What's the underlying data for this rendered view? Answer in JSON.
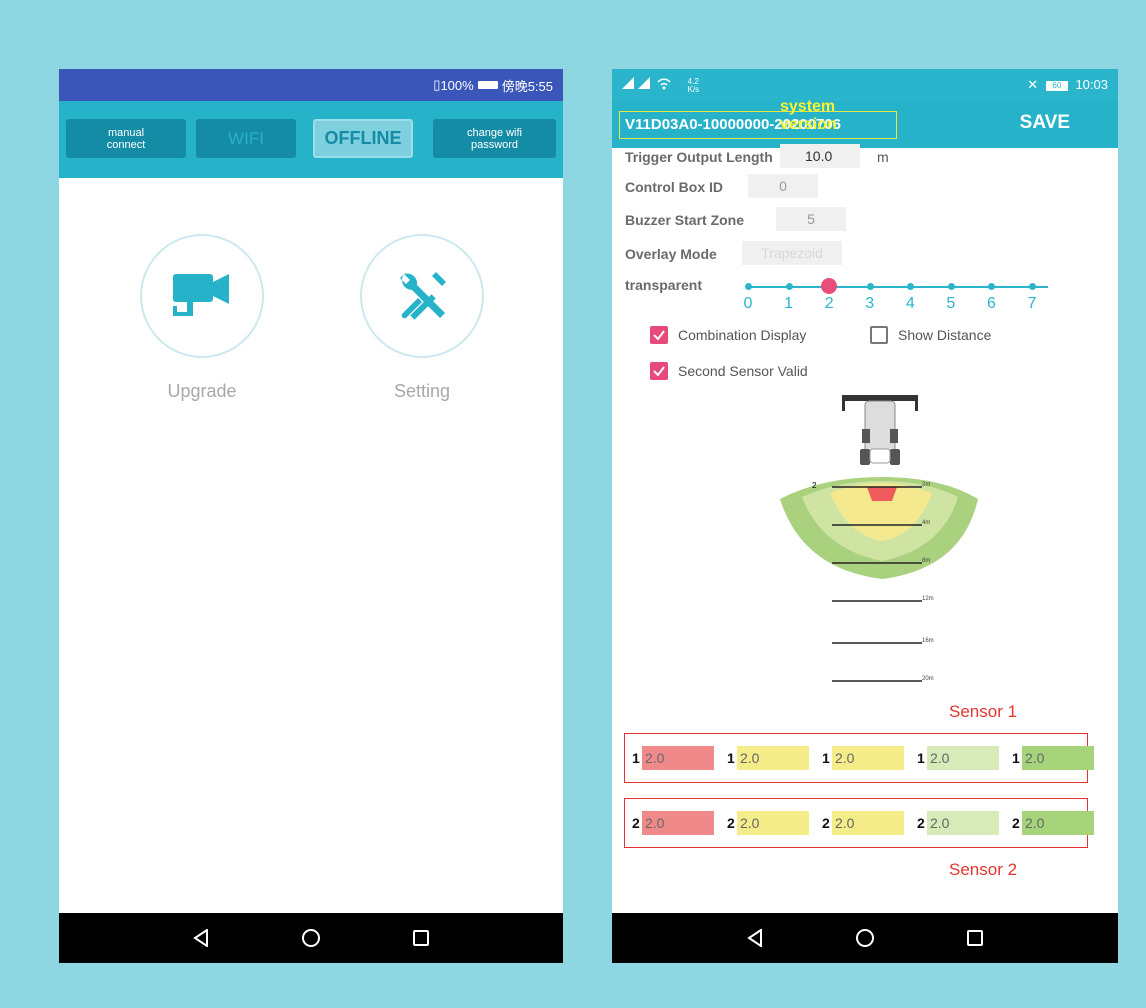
{
  "left_phone": {
    "status": {
      "sim_icon": "sim-icon",
      "battery_percent": "100%",
      "time": "傍晚5:55"
    },
    "toolbar": {
      "manual_connect": [
        "manual",
        "connect"
      ],
      "wifi": "WIFI",
      "offline": "OFFLINE",
      "change_wifi_password": [
        "change wifi",
        "password"
      ]
    },
    "menu": [
      {
        "label": "Upgrade",
        "icon": "camera-icon"
      },
      {
        "label": "Setting",
        "icon": "tools-icon"
      }
    ],
    "nav": [
      "back-icon",
      "home-icon",
      "recents-icon"
    ]
  },
  "right_phone": {
    "status": {
      "network_speed": "4.2",
      "network_speed_unit": "K/s",
      "battery_level": "60",
      "time": "10:03"
    },
    "version_note": "system  version",
    "version": "V11D03A0-10000000-20200706",
    "save_label": "SAVE",
    "fields": {
      "trigger_label": "Trigger Output Length",
      "trigger_value": "10.0",
      "trigger_unit": "m",
      "box_id_label": "Control Box ID",
      "box_id_value": "0",
      "buzzer_label": "Buzzer Start Zone",
      "buzzer_value": "5",
      "overlay_label": "Overlay Mode",
      "overlay_value": "Trapezoid",
      "transparent_label": "transparent"
    },
    "slider": {
      "ticks": [
        "0",
        "1",
        "2",
        "3",
        "4",
        "5",
        "6",
        "7"
      ],
      "value": 2
    },
    "checkboxes": {
      "combination_display": {
        "label": "Combination Display",
        "checked": true
      },
      "show_distance": {
        "label": "Show Distance",
        "checked": false
      },
      "second_sensor_valid": {
        "label": "Second Sensor Valid",
        "checked": true
      }
    },
    "diagram": {
      "sensor_marker": "2",
      "distances": [
        "2m",
        "4m",
        "8m",
        "12m",
        "16m",
        "20m"
      ]
    },
    "sensor1": {
      "label": "Sensor 1",
      "cells": [
        {
          "n": "1",
          "v": "2.0",
          "color": "#f08a8a"
        },
        {
          "n": "1",
          "v": "2.0",
          "color": "#f5ec8a"
        },
        {
          "n": "1",
          "v": "2.0",
          "color": "#f5ec8a"
        },
        {
          "n": "1",
          "v": "2.0",
          "color": "#d7ebb8"
        },
        {
          "n": "1",
          "v": "2.0",
          "color": "#a5d47a"
        }
      ]
    },
    "sensor2": {
      "label": "Sensor 2",
      "cells": [
        {
          "n": "2",
          "v": "2.0",
          "color": "#f08a8a"
        },
        {
          "n": "2",
          "v": "2.0",
          "color": "#f5ec8a"
        },
        {
          "n": "2",
          "v": "2.0",
          "color": "#f5ec8a"
        },
        {
          "n": "2",
          "v": "2.0",
          "color": "#d7ebb8"
        },
        {
          "n": "2",
          "v": "2.0",
          "color": "#a5d47a"
        }
      ]
    },
    "nav": [
      "back-icon",
      "home-icon",
      "recents-icon"
    ]
  }
}
